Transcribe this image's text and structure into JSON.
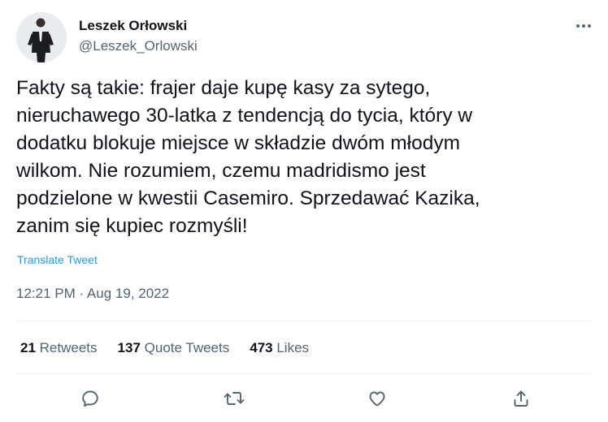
{
  "author": {
    "name": "Leszek Orłowski",
    "handle": "@Leszek_Orlowski"
  },
  "tweet": {
    "text": "Fakty są takie: frajer daje kupę kasy za sytego,\nnieruchawego 30-latka z tendencją do tycia, który w\ndodatku blokuje miejsce w składzie dwóm młodym\nwilkom. Nie rozumiem, czemu madridismo jest\npodzielone w kwestii Casemiro. Sprzedawać Kazika,\nzanim się kupiec rozmyśli!",
    "translate_label": "Translate Tweet",
    "timestamp": "12:21 PM · Aug 19, 2022"
  },
  "stats": {
    "retweets_count": "21",
    "retweets_label": "Retweets",
    "quotes_count": "137",
    "quotes_label": "Quote Tweets",
    "likes_count": "473",
    "likes_label": "Likes"
  },
  "icons": {
    "more": "more-horizontal-icon",
    "reply": "reply-icon",
    "retweet": "retweet-icon",
    "like": "like-heart-icon",
    "share": "share-icon"
  },
  "colors": {
    "text": "#0f1419",
    "secondary": "#536471",
    "link": "#1d9bf0",
    "divider": "#eff3f4"
  }
}
